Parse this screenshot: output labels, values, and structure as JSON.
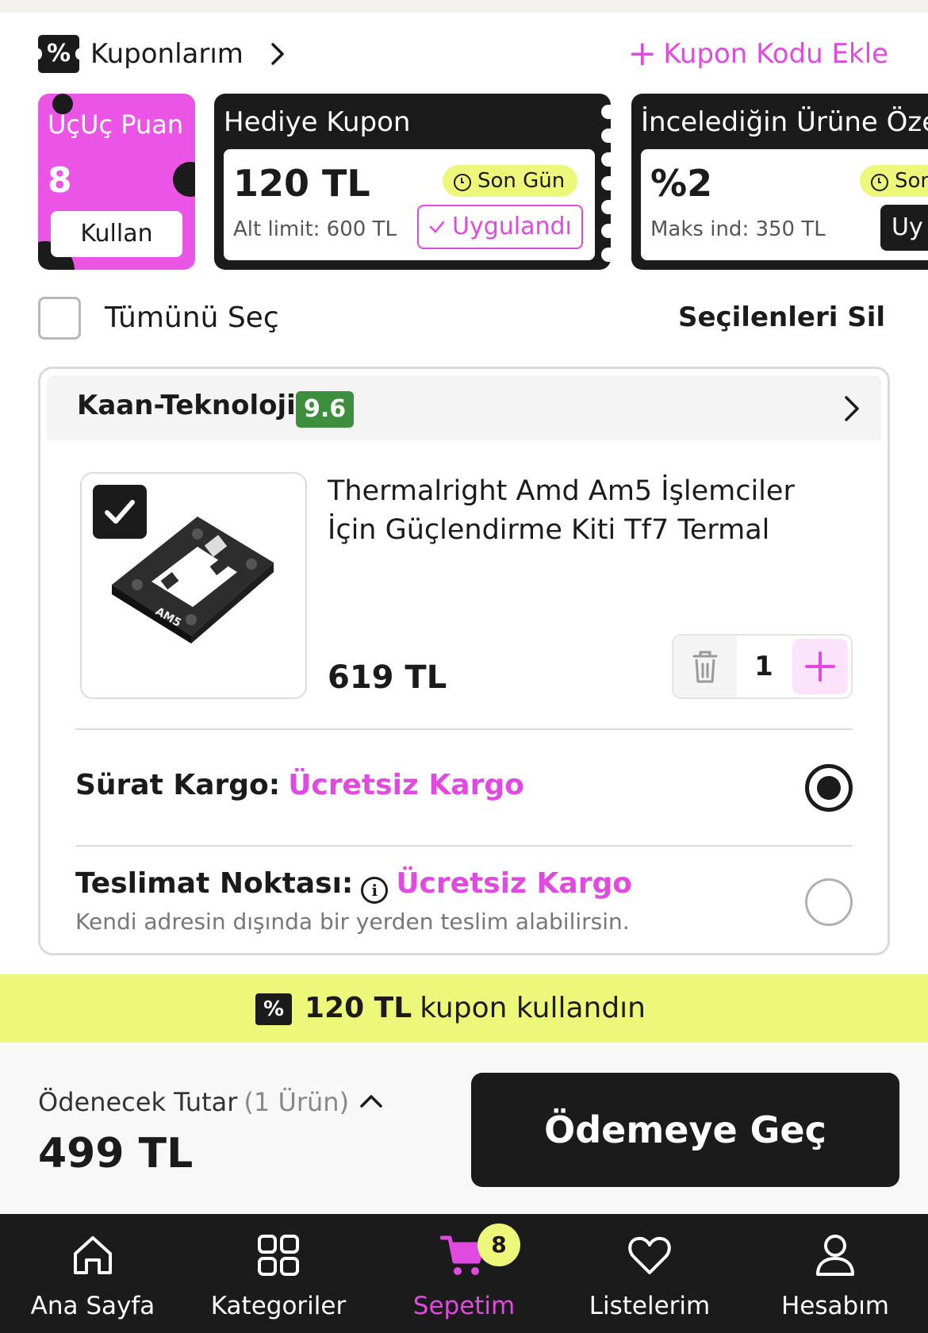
{
  "coupons": {
    "title": "Kuponlarım",
    "badge_symbol": "%",
    "add_code_label": "Kupon Kodu Ekle",
    "points_card": {
      "title": "UçUç Puan",
      "value": "8",
      "button": "Kullan"
    },
    "gift_card": {
      "title": "Hediye Kupon",
      "amount": "120 TL",
      "limit": "Alt limit: 600 TL",
      "tag": "Son Gün",
      "button": "Uygulandı"
    },
    "special_card": {
      "title": "İncelediğin Ürüne Özel",
      "amount": "%2",
      "limit": "Maks ind: 350 TL",
      "tag": "Son",
      "button": "Uy"
    }
  },
  "selection": {
    "select_all": "Tümünü Seç",
    "delete_selected": "Seçilenleri Sil"
  },
  "seller": {
    "name": "Kaan-Teknoloji",
    "score": "9.6",
    "product": {
      "title": "Thermalright Amd Am5 İşlemciler İçin Güçlendirme Kiti Tf7 Termal",
      "price": "619 TL",
      "quantity": "1",
      "image_text": "AM5"
    },
    "shipping_options": [
      {
        "label": "Sürat Kargo:",
        "price": "Ücretsiz Kargo",
        "selected": true
      },
      {
        "label": "Teslimat Noktası:",
        "price": "Ücretsiz Kargo",
        "subtitle": "Kendi adresin dışında bir yerden teslim alabilirsin.",
        "selected": false
      }
    ]
  },
  "coupon_used": {
    "amount": "120 TL",
    "text": "kupon kullandın"
  },
  "total": {
    "label": "Ödenecek Tutar",
    "count": "(1 Ürün)",
    "amount": "499 TL",
    "checkout": "Ödemeye Geç"
  },
  "nav": {
    "items": [
      {
        "label": "Ana Sayfa",
        "icon": "home-icon"
      },
      {
        "label": "Kategoriler",
        "icon": "grid-icon"
      },
      {
        "label": "Sepetim",
        "icon": "cart-icon",
        "badge": "8",
        "active": true
      },
      {
        "label": "Listelerim",
        "icon": "heart-icon"
      },
      {
        "label": "Hesabım",
        "icon": "user-icon"
      }
    ]
  },
  "colors": {
    "accent": "#e14ae0",
    "highlight": "#edf77a",
    "dark": "#1b1b1b",
    "score_green": "#3d8f3d"
  }
}
